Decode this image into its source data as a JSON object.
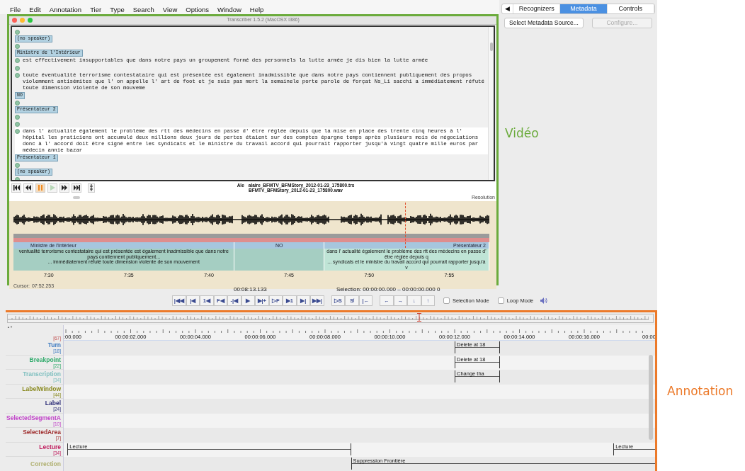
{
  "menu": [
    "File",
    "Edit",
    "Annotation",
    "Tier",
    "Type",
    "Search",
    "View",
    "Options",
    "Window",
    "Help"
  ],
  "transcriber": {
    "title": "Transcriber 1.5.2 (MacOSX i386)",
    "transcript": [
      {
        "kind": "sync",
        "selected": false
      },
      {
        "kind": "speaker",
        "text": "(no speaker)"
      },
      {
        "kind": "sync",
        "selected": false
      },
      {
        "kind": "speaker",
        "text": "Ministre de l'Intérieur"
      },
      {
        "kind": "sync",
        "selected": false,
        "text": "est effectivement insupportables que dans notre pays un groupement formé des personnels la lutte armée je dis bien la lutte armée"
      },
      {
        "kind": "sync",
        "selected": false
      },
      {
        "kind": "sync",
        "selected": false,
        "text": "toute éventualité terrorisme contestataire qui est présentée est également inadmissible que dans notre pays contiennent publiquement des propos violemment antisémites que l' on appelle l' art de foot et je suis pas mort la semainele porte parole de forçat Ns_Li sacchi a immédiatement réfuté toute dimension violente de son mouvemе"
      },
      {
        "kind": "speaker",
        "text": "NO"
      },
      {
        "kind": "sync",
        "selected": false
      },
      {
        "kind": "speaker",
        "text": "Présentateur 2"
      },
      {
        "kind": "sync",
        "selected": false
      },
      {
        "kind": "sync",
        "selected": false
      },
      {
        "kind": "sync",
        "selected": true,
        "text": "dans l' actualité également le problème des rtt des médecins en passe d' être réglée depuis que la mise en place des trente cinq heures à l' hôpital les praticiens ont accumulé deux millions deux jours de pertes étaient sur des comptes épargne temps après plusieurs mois de négociations donc à l' accord doit être signé entre les syndicats et le ministre du travail accord qui pourrait rapporter jusqu'à vingt quatre mille euros par médecin annie bazar"
      },
      {
        "kind": "speaker",
        "text": "Présentateur 1"
      },
      {
        "kind": "sync",
        "selected": false
      },
      {
        "kind": "speaker",
        "text": "(no speaker)"
      },
      {
        "kind": "sync",
        "selected": false
      }
    ],
    "player_buttons": [
      {
        "kind": "first",
        "active": false,
        "disabled": false
      },
      {
        "kind": "rewind",
        "active": false,
        "disabled": false
      },
      {
        "kind": "pause",
        "active": true,
        "disabled": false
      },
      {
        "kind": "play",
        "active": false,
        "disabled": true
      },
      {
        "kind": "forward",
        "active": false,
        "disabled": false
      },
      {
        "kind": "last",
        "active": false,
        "disabled": false
      },
      {
        "kind": "split",
        "active": false,
        "disabled": false
      }
    ],
    "file_label": "Ale",
    "trs_file": "alaire_BFMTV_BFMStory_2012-01-23_175800.trs",
    "wav_file": "BFMTV_BFMStory_2012-01-23_175800.wav",
    "resolution_label": "Resolution",
    "segments": [
      {
        "speaker": "Ministre de l'Intérieur",
        "lines": [
          "ventualité terrorisme contestataire qui est présentée est également inadmissible que dans notre pays contiennent publiquement...",
          "... immédiatement réfuté toute dimension violente de son mouvement"
        ]
      },
      {
        "speaker": "NO"
      },
      {
        "speaker": "Présentateur 2",
        "lines": [
          "dans l' actualité également le problème des rtt des médecins en passe d' être réglée depuis q",
          "... syndicats et le ministre du travail accord qui pourrait rapporter jusqu'à v"
        ]
      }
    ],
    "time_labels": [
      "7:30",
      "7:35",
      "7:40",
      "7:45",
      "7:50",
      "7:55"
    ],
    "cursor": {
      "label": "Cursor:",
      "time": "07:52.253"
    }
  },
  "right_panel": {
    "tabs": [
      {
        "label": "◀",
        "selected": false
      },
      {
        "label": "Recognizers",
        "selected": false
      },
      {
        "label": "Metadata",
        "selected": true
      },
      {
        "label": "Controls",
        "selected": false
      }
    ],
    "buttons": [
      {
        "label": "Select Metadata Source...",
        "disabled": false
      },
      {
        "label": "Configure...",
        "disabled": true
      }
    ]
  },
  "video_label": "Vidéo",
  "media_controls": {
    "time": "00:08:13.133",
    "selection": "Selection: 00:00:00.000 – 00:00:00.000  0",
    "button_groups": [
      [
        "|◀◀",
        "|◀",
        "1◀",
        "F◀",
        "-|◀",
        "▶",
        "▶|+",
        "▷F",
        "▶1",
        "▶|",
        "▶▶|"
      ],
      [
        "▷S",
        "S̸",
        "|←"
      ],
      [
        "←",
        "→",
        "↓",
        "↑"
      ]
    ],
    "checkboxes": [
      {
        "label": "Selection Mode",
        "checked": false
      },
      {
        "label": "Loop Mode",
        "checked": false
      }
    ]
  },
  "annotation": {
    "sort_arrows": "▲▼",
    "hidden_tier_count": "[67]",
    "ruler": [
      ":00.000",
      "00:00:02.000",
      "00:00:04.000",
      "00:00:06.000",
      "00:00:08.000",
      "00:00:10.000",
      "00:00:12.000",
      "00:00:14.000",
      "00:00:16.000",
      "00:00"
    ],
    "tiers": [
      {
        "name": "Turn",
        "count": "[18]",
        "color": "#3a78c0",
        "annotations": [
          {
            "text": "Delete at 18"
          }
        ]
      },
      {
        "name": "Breakpoint",
        "count": "[22]",
        "color": "#2eaa6a",
        "annotations": [
          {
            "text": "Delete at 18"
          }
        ]
      },
      {
        "name": "Transcription",
        "count": "[34]",
        "color": "#80c0c0",
        "annotations": [
          {
            "text": "Change tha"
          }
        ]
      },
      {
        "name": "LabelWindow",
        "count": "[44]",
        "color": "#8a8a20"
      },
      {
        "name": "Label",
        "count": "[24]",
        "color": "#30307a"
      },
      {
        "name": "SelectedSegmentA",
        "count": "[10]",
        "color": "#c040c8"
      },
      {
        "name": "SelectedArea",
        "count": "[7]",
        "color": "#a03030"
      },
      {
        "name": "Lecture",
        "count": "[34]",
        "color": "#c02060",
        "annotations": [
          {
            "text": "Lecture"
          },
          {
            "text": "Lecture"
          }
        ]
      },
      {
        "name": "Correction",
        "color": "#b0b070",
        "annotations": [
          {
            "text": "Suppression Frontière"
          }
        ]
      }
    ]
  },
  "annotation_label": "Annotation"
}
